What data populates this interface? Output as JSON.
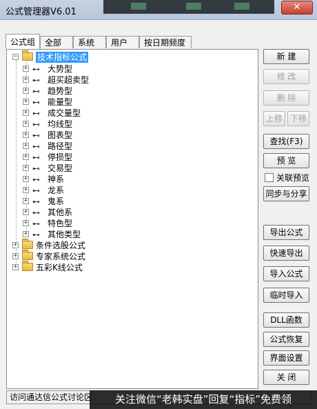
{
  "window": {
    "title": "公式管理器V6.01",
    "close_label": "✕"
  },
  "tabs": [
    "公式组",
    "全部",
    "系统",
    "用户",
    "按日期频度"
  ],
  "tree": {
    "root": {
      "label": "技术指标公式"
    },
    "children": [
      "大势型",
      "超买超卖型",
      "趋势型",
      "能量型",
      "成交量型",
      "均线型",
      "图表型",
      "路径型",
      "停损型",
      "交易型",
      "神系",
      "龙系",
      "鬼系",
      "其他系",
      "特色型",
      "其他类型"
    ],
    "groups": [
      "条件选股公式",
      "专家系统公式",
      "五彩K线公式"
    ]
  },
  "buttons": {
    "new": "新  建",
    "modify": "修  改",
    "delete": "删  除",
    "move_up": "上移",
    "move_down": "下移",
    "find": "查找(F3)",
    "preview": "预  览",
    "linked_preview": "关联预览",
    "sync_share": "同步与分享",
    "export": "导出公式",
    "quick_export": "快速导出",
    "import": "导入公式",
    "temp_import": "临时导入",
    "dll": "DLL函数",
    "restore": "公式恢复",
    "ui_settings": "界面设置",
    "close": "关  闭"
  },
  "status": {
    "text": "访问通达信公式讨论区"
  },
  "overlay": {
    "text": "关注微信“老韩实盘”回复“指标”免费领"
  }
}
